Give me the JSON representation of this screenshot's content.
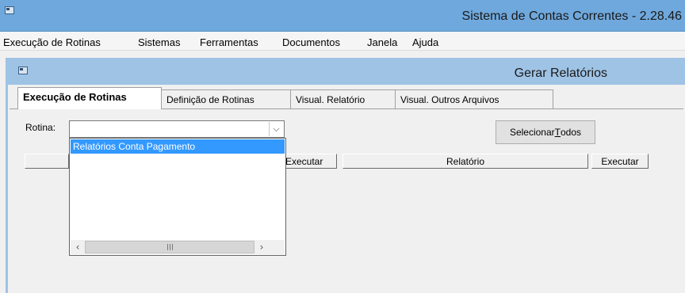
{
  "app": {
    "title": "Sistema de Contas Correntes - 2.28.46"
  },
  "menu": [
    "Execução de Rotinas",
    "Sistemas",
    "Ferramentas",
    "Documentos",
    "Janela",
    "Ajuda"
  ],
  "child": {
    "title": "Gerar Relatórios"
  },
  "tabs": [
    "Execução de Rotinas",
    "Definição de Rotinas",
    "Visual. Relatório",
    "Visual. Outros Arquivos"
  ],
  "form": {
    "rotina_label": "Rotina:",
    "rotina_value": "",
    "select_all_prefix": "Selecionar ",
    "select_all_underline": "T",
    "select_all_suffix": "odos"
  },
  "grid": {
    "col_left_exec": "Executar",
    "col_relatorio": "Relatório",
    "col_right_exec": "Executar"
  },
  "dropdown": {
    "options": [
      "Relatórios Conta Pagamento"
    ]
  },
  "colors": {
    "title_bar": "#6fa8dc",
    "child_title": "#9fc3e5",
    "selection": "#3399ff"
  }
}
